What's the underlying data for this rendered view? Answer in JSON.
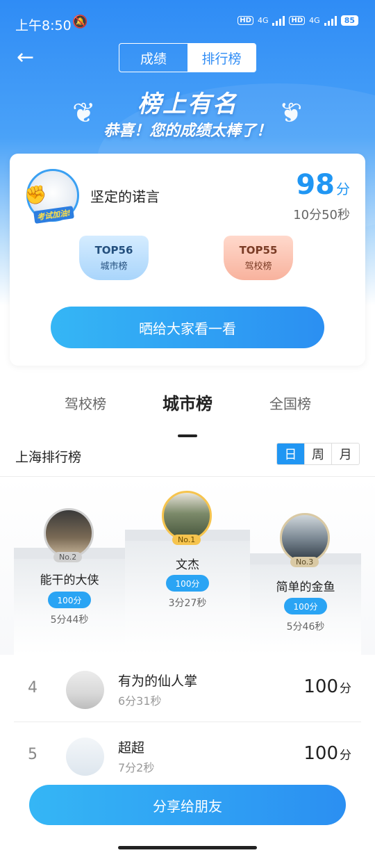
{
  "status_bar": {
    "time": "上午8:50",
    "hd1": "HD",
    "net1": "4G",
    "hd2": "HD",
    "net2": "4G",
    "battery": "85"
  },
  "header": {
    "tabs": [
      "成绩",
      "排行榜"
    ],
    "active_tab": "排行榜"
  },
  "banner": {
    "title": "榜上有名",
    "subtitle": "恭喜！您的成绩太棒了！",
    "badge_text": "考试加油!"
  },
  "result_card": {
    "user_name": "坚定的诺言",
    "score": "98",
    "score_unit": "分",
    "duration": "10分50秒",
    "medals": [
      {
        "rank": "TOP56",
        "label": "城市榜"
      },
      {
        "rank": "TOP55",
        "label": "驾校榜"
      }
    ],
    "share_button": "晒给大家看一看"
  },
  "leaderboard": {
    "tabs": [
      "驾校榜",
      "城市榜",
      "全国榜"
    ],
    "active_tab": "城市榜",
    "title": "上海排行榜",
    "periods": [
      "日",
      "周",
      "月"
    ],
    "active_period": "日",
    "podium": [
      {
        "rank_label": "No.1",
        "name": "文杰",
        "score": "100分",
        "time": "3分27秒"
      },
      {
        "rank_label": "No.2",
        "name": "能干的大侠",
        "score": "100分",
        "time": "5分44秒"
      },
      {
        "rank_label": "No.3",
        "name": "简单的金鱼",
        "score": "100分",
        "time": "5分46秒"
      }
    ],
    "rows": [
      {
        "rank": "4",
        "name": "有为的仙人掌",
        "time": "6分31秒",
        "score": "100",
        "unit": "分"
      },
      {
        "rank": "5",
        "name": "超超",
        "time": "7分2秒",
        "score": "100",
        "unit": "分"
      }
    ]
  },
  "bottom_button": "分享给朋友",
  "colors": {
    "accent": "#2096f3",
    "hero_top": "#2f8cf5",
    "gold": "#f6c44e"
  }
}
